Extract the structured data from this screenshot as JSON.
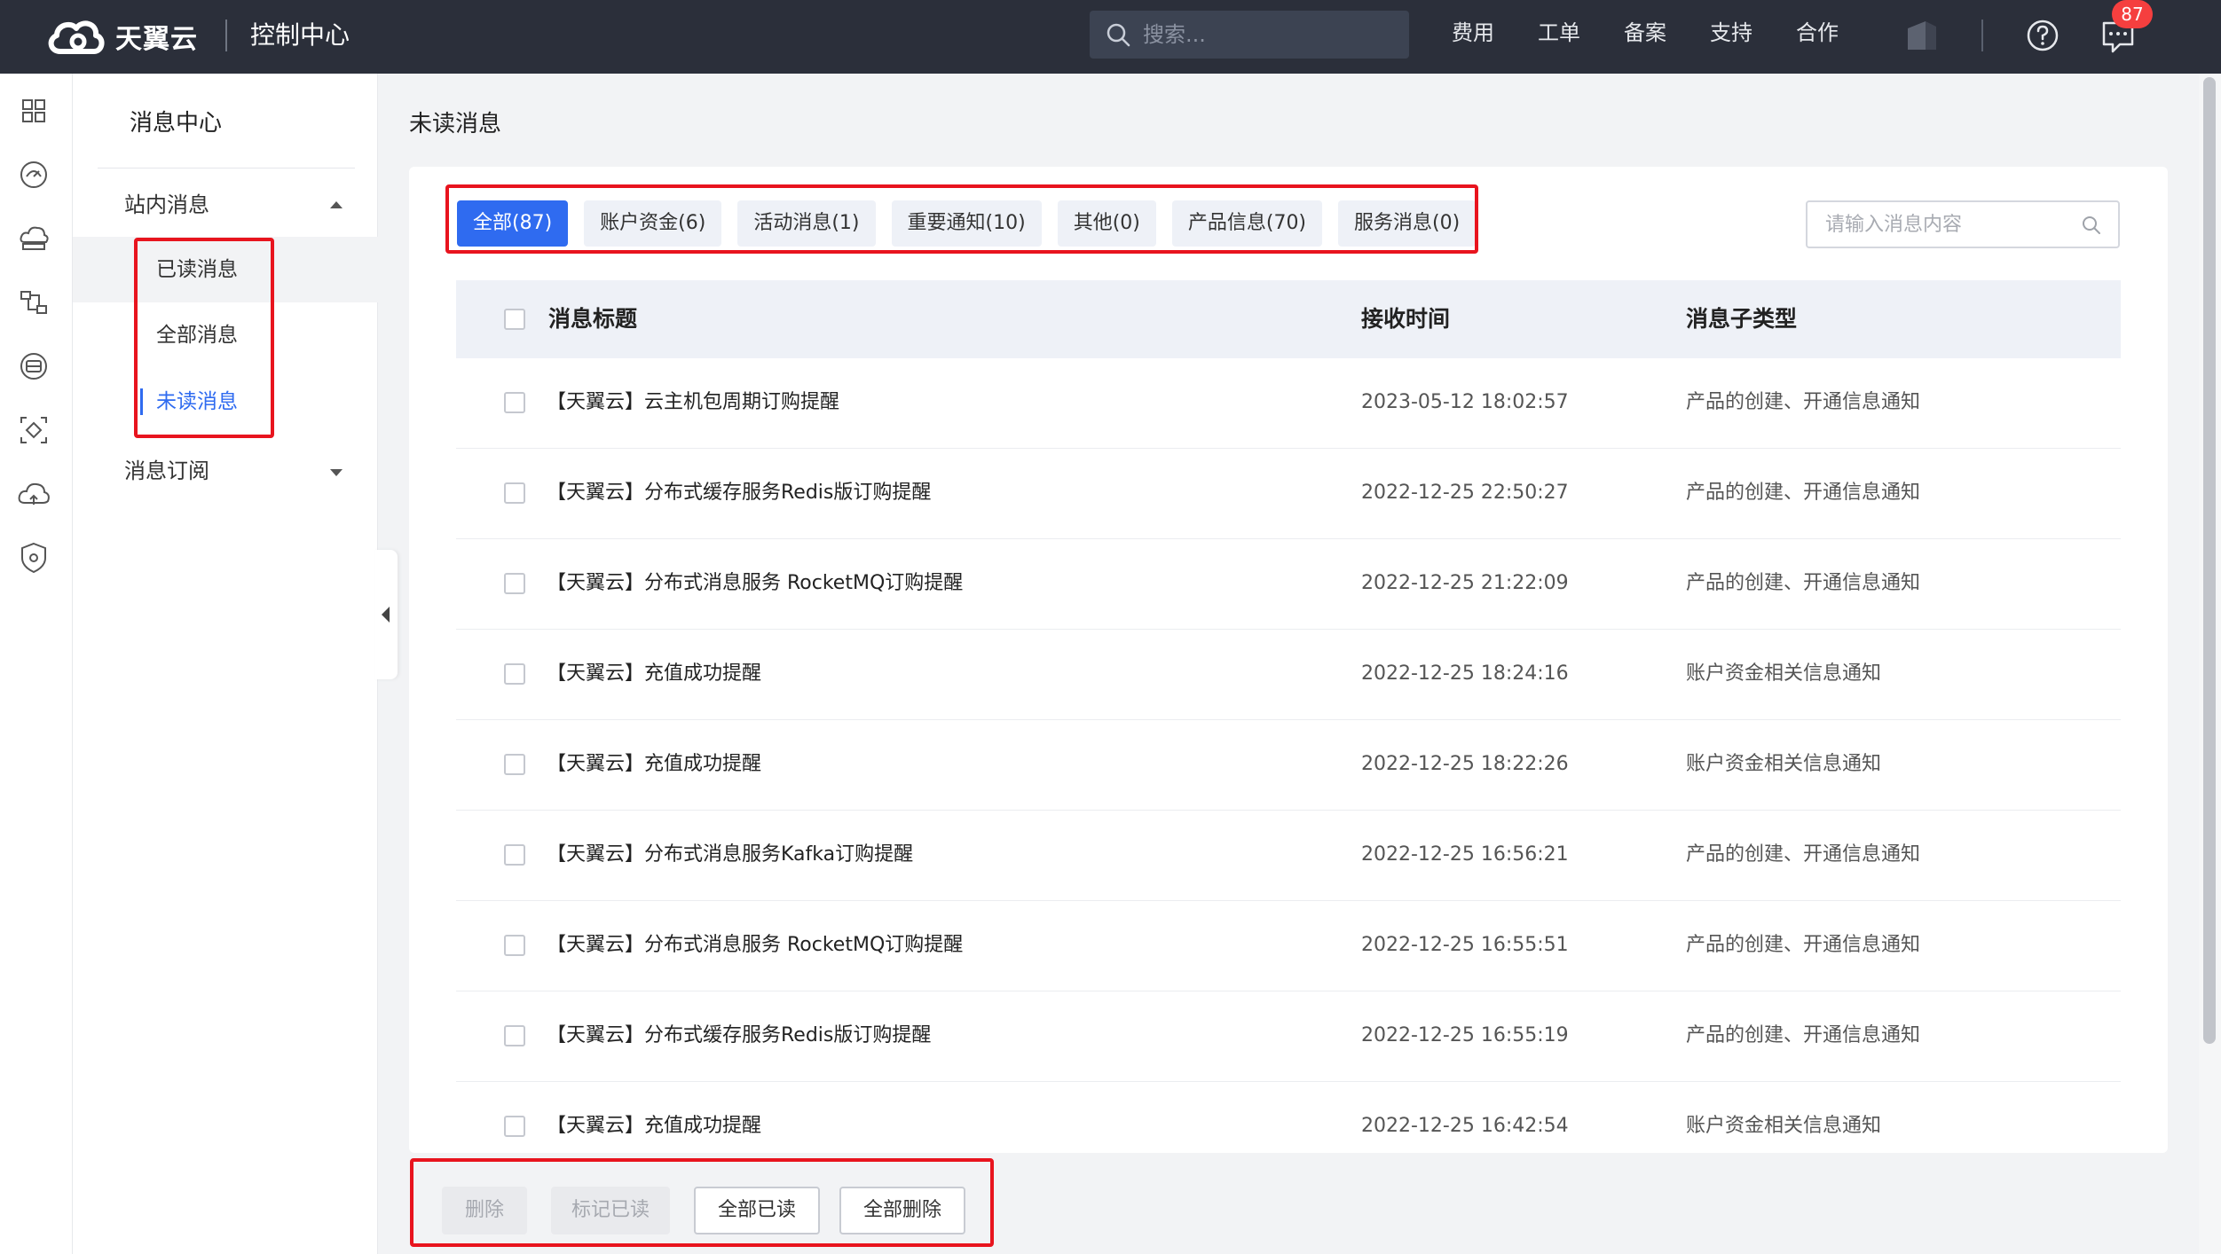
{
  "header": {
    "logo_text": "天翼云",
    "console_title": "控制中心",
    "search_placeholder": "搜索...",
    "nav": [
      "费用",
      "工单",
      "备案",
      "支持",
      "合作"
    ],
    "notification_count": "87"
  },
  "rail": {
    "icons": [
      "dashboard-icon",
      "speedometer-icon",
      "cloud-server-icon",
      "network-topology-icon",
      "database-icon",
      "scan-icon",
      "cloud-icon",
      "shield-icon"
    ]
  },
  "sidebar": {
    "title": "消息中心",
    "group_site": "站内消息",
    "items": [
      {
        "label": "已读消息"
      },
      {
        "label": "全部消息"
      },
      {
        "label": "未读消息"
      }
    ],
    "group_subscribe": "消息订阅"
  },
  "main": {
    "page_title": "未读消息",
    "tabs": [
      {
        "label": "全部(87)",
        "active": true
      },
      {
        "label": "账户资金(6)"
      },
      {
        "label": "活动消息(1)"
      },
      {
        "label": "重要通知(10)"
      },
      {
        "label": "其他(0)"
      },
      {
        "label": "产品信息(70)"
      },
      {
        "label": "服务消息(0)"
      }
    ],
    "search_placeholder": "请输入消息内容",
    "columns": {
      "title": "消息标题",
      "time": "接收时间",
      "type": "消息子类型"
    },
    "rows": [
      {
        "title": "【天翼云】云主机包周期订购提醒",
        "time": "2023-05-12 18:02:57",
        "type": "产品的创建、开通信息通知"
      },
      {
        "title": "【天翼云】分布式缓存服务Redis版订购提醒",
        "time": "2022-12-25 22:50:27",
        "type": "产品的创建、开通信息通知"
      },
      {
        "title": "【天翼云】分布式消息服务 RocketMQ订购提醒",
        "time": "2022-12-25 21:22:09",
        "type": "产品的创建、开通信息通知"
      },
      {
        "title": "【天翼云】充值成功提醒",
        "time": "2022-12-25 18:24:16",
        "type": "账户资金相关信息通知"
      },
      {
        "title": "【天翼云】充值成功提醒",
        "time": "2022-12-25 18:22:26",
        "type": "账户资金相关信息通知"
      },
      {
        "title": "【天翼云】分布式消息服务Kafka订购提醒",
        "time": "2022-12-25 16:56:21",
        "type": "产品的创建、开通信息通知"
      },
      {
        "title": "【天翼云】分布式消息服务 RocketMQ订购提醒",
        "time": "2022-12-25 16:55:51",
        "type": "产品的创建、开通信息通知"
      },
      {
        "title": "【天翼云】分布式缓存服务Redis版订购提醒",
        "time": "2022-12-25 16:55:19",
        "type": "产品的创建、开通信息通知"
      },
      {
        "title": "【天翼云】充值成功提醒",
        "time": "2022-12-25 16:42:54",
        "type": "账户资金相关信息通知"
      }
    ]
  },
  "footer": {
    "delete": "删除",
    "mark_read": "标记已读",
    "mark_all_read": "全部已读",
    "delete_all": "全部删除"
  },
  "colors": {
    "accent": "#2f6bf0",
    "topbar": "#2b2f3a",
    "annotation": "#e8141e",
    "badge": "#f53f3f"
  }
}
